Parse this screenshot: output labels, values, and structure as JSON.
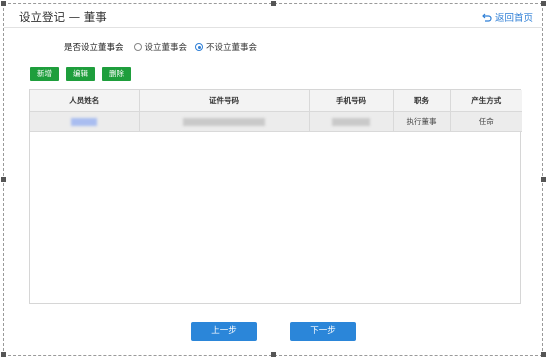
{
  "header": {
    "title": "设立登记 — 董事",
    "back_label": "返回首页"
  },
  "board_question": {
    "label": "是否设立董事会",
    "options": [
      {
        "label": "设立董事会",
        "checked": false
      },
      {
        "label": "不设立董事会",
        "checked": true
      }
    ]
  },
  "toolbar": {
    "add_label": "新增",
    "edit_label": "编辑",
    "delete_label": "删除"
  },
  "table": {
    "columns": [
      "人员姓名",
      "证件号码",
      "手机号码",
      "职务",
      "产生方式"
    ],
    "rows": [
      {
        "name": "",
        "id_number": "",
        "phone": "",
        "position": "执行董事",
        "method": "任命"
      }
    ]
  },
  "footer": {
    "prev_label": "上一步",
    "next_label": "下一步"
  },
  "colors": {
    "accent_blue": "#2b86d9",
    "action_green": "#1e9e3c",
    "link_blue": "#2f7fd6"
  }
}
